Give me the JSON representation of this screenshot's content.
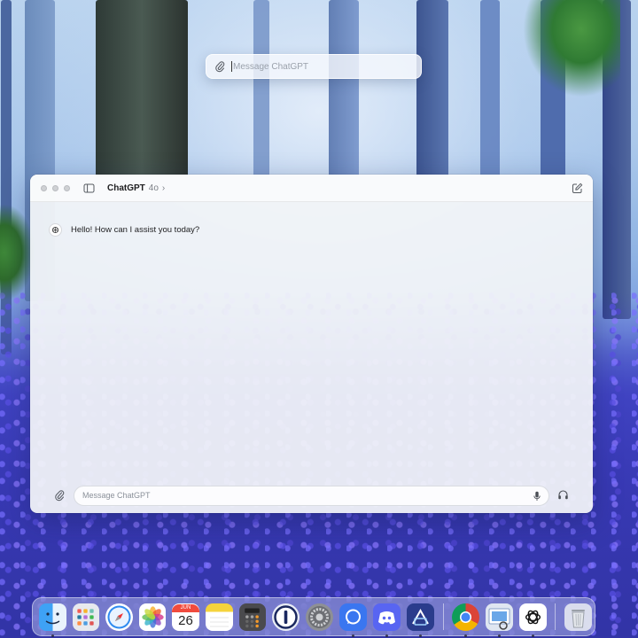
{
  "quick_bar": {
    "placeholder": "Message ChatGPT",
    "attach_icon": "paperclip-icon"
  },
  "window": {
    "model_name": "ChatGPT",
    "model_version": "4o",
    "model_chevron": "›",
    "sidebar_icon": "sidebar-icon",
    "new_chat_icon": "compose-icon",
    "messages": [
      {
        "role": "assistant",
        "text": "Hello! How can I assist you today?"
      }
    ],
    "composer": {
      "placeholder": "Message ChatGPT",
      "attach_icon": "paperclip-icon",
      "mic_icon": "microphone-icon",
      "voice_icon": "headphones-icon"
    }
  },
  "calendar": {
    "month": "JUN",
    "day": "26"
  },
  "dock": {
    "items": [
      {
        "name": "Finder",
        "icon": "finder-icon",
        "running": true
      },
      {
        "name": "Launchpad",
        "icon": "launchpad-icon",
        "running": false
      },
      {
        "name": "Safari",
        "icon": "safari-icon",
        "running": false
      },
      {
        "name": "Photos",
        "icon": "photos-icon",
        "running": false
      },
      {
        "name": "Calendar",
        "icon": "calendar-icon",
        "running": false
      },
      {
        "name": "Notes",
        "icon": "notes-icon",
        "running": false
      },
      {
        "name": "Calculator",
        "icon": "calculator-icon",
        "running": false
      },
      {
        "name": "1Password",
        "icon": "onepassword-icon",
        "running": false
      },
      {
        "name": "System Settings",
        "icon": "settings-icon",
        "running": false
      },
      {
        "name": "Signal",
        "icon": "signal-icon",
        "running": true
      },
      {
        "name": "Discord",
        "icon": "discord-icon",
        "running": true
      },
      {
        "name": "Jump Desktop",
        "icon": "jumpdesk-icon",
        "running": true
      },
      {
        "name": "Google Chrome",
        "icon": "chrome-icon",
        "running": true
      },
      {
        "name": "Preview",
        "icon": "preview-icon",
        "running": true
      },
      {
        "name": "ChatGPT",
        "icon": "chatgpt-icon",
        "running": true
      },
      {
        "name": "Trash",
        "icon": "trash-icon",
        "running": false
      }
    ]
  },
  "colors": {
    "calendar_red": "#f04b3e",
    "signal_blue": "#3a76f0",
    "discord_purple": "#5865f2"
  }
}
